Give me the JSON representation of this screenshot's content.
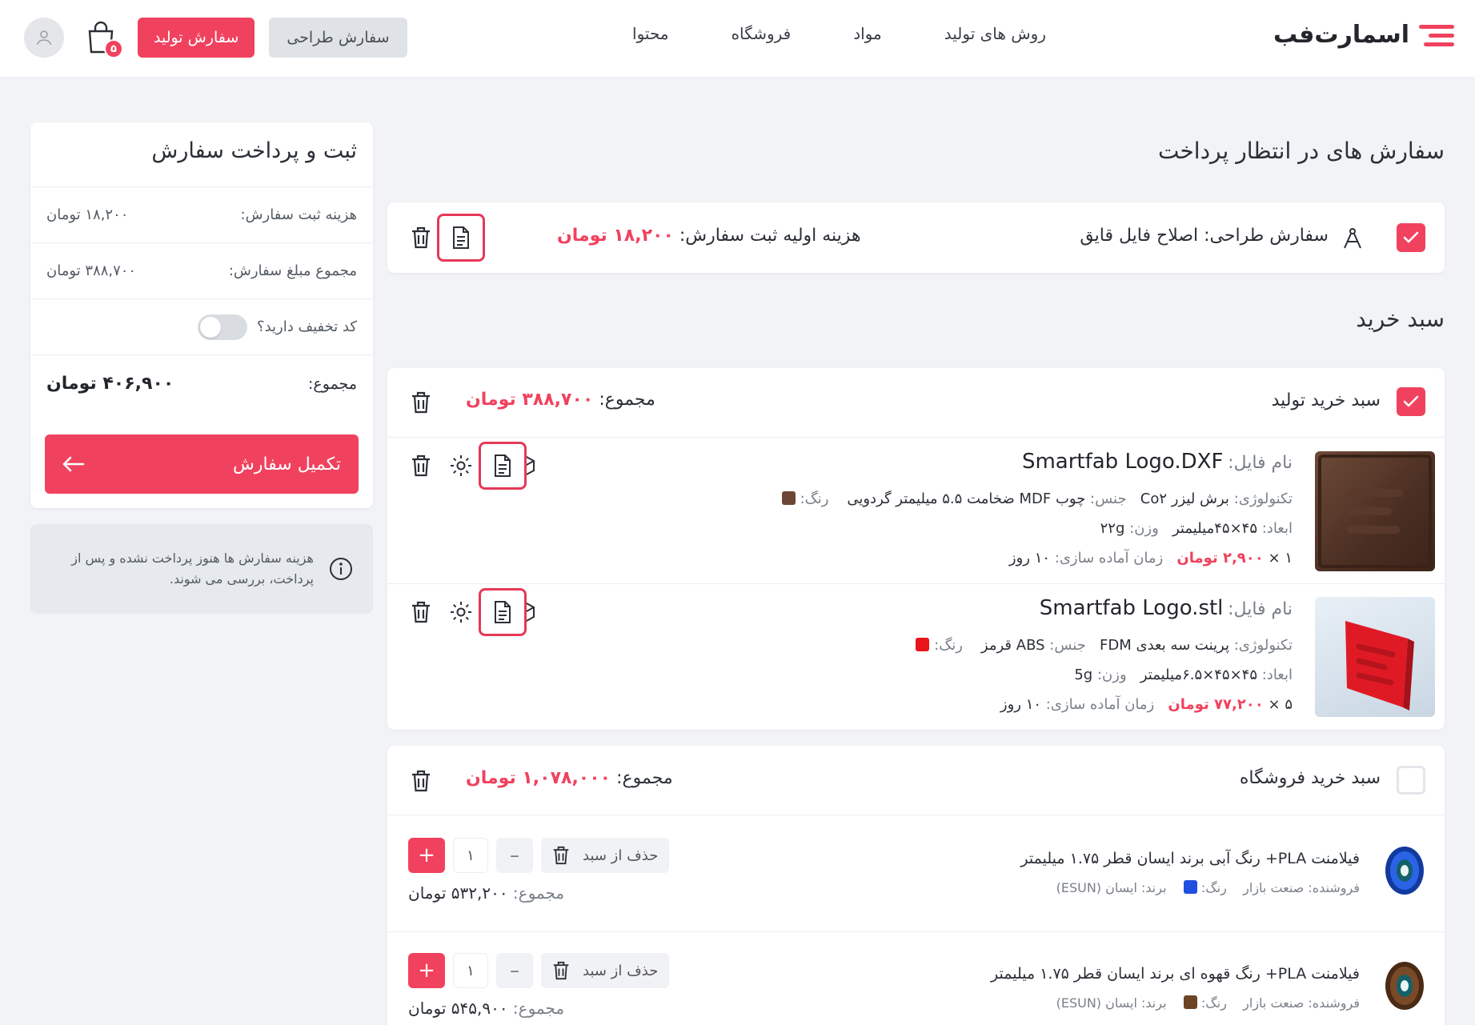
{
  "header": {
    "logo_text": "اسمارت‌فب",
    "nav": [
      "روش های تولید",
      "مواد",
      "فروشگاه",
      "محتوا"
    ],
    "design_order_label": "سفارش طراحی",
    "production_order_label": "سفارش تولید",
    "cart_count": "۵"
  },
  "summary": {
    "title": "ثبت و پرداخت سفارش",
    "reg_fee_label": "هزینه ثبت سفارش:",
    "reg_fee_value": "۱۸,۲۰۰ تومان",
    "order_total_label": "مجموع مبلغ سفارش:",
    "order_total_value": "۳۸۸,۷۰۰ تومان",
    "discount_label": "کد تخفیف دارید؟",
    "total_label": "مجموع:",
    "total_value": "۴۰۶,۹۰۰ تومان",
    "complete_label": "تکمیل سفارش",
    "info_text": "هزینه سفارش ها هنوز پرداخت نشده و پس از پرداخت، بررسی می شوند."
  },
  "pending": {
    "title": "سفارش های در انتظار پرداخت",
    "label": "سفارش طراحی:",
    "name": "اصلاح فایل قایق",
    "fee_label": "هزینه اولیه ثبت سفارش:",
    "fee_value": "۱۸,۲۰۰ تومان"
  },
  "cart": {
    "title": "سبد خرید",
    "production": {
      "title": "سبد خرید تولید",
      "total_label": "مجموع:",
      "total_value": "۳۸۸,۷۰۰ تومان",
      "items": [
        {
          "file_label": "نام فایل:",
          "file_name": "Smartfab Logo.DXF",
          "tech_label": "تکنولوژی:",
          "tech": "برش لیزر Co۲",
          "material_label": "جنس:",
          "material": "چوب MDF ضخامت ۵.۵ میلیمتر گردویی",
          "color_label": "رنگ:",
          "color": "#6b4634",
          "dims_label": "ابعاد:",
          "dims": "۴۵×۴۵میلیمتر",
          "weight_label": "وزن:",
          "weight": "۲۲g",
          "qty": "۱ ×",
          "price": "۲,۹۰۰ تومان",
          "prep_label": "زمان آماده سازی:",
          "prep": "۱۰ روز"
        },
        {
          "file_label": "نام فایل:",
          "file_name": "Smartfab Logo.stl",
          "tech_label": "تکنولوژی:",
          "tech": "پرینت سه بعدی FDM",
          "material_label": "جنس:",
          "material": "ABS قرمز",
          "color_label": "رنگ:",
          "color": "#e8141a",
          "dims_label": "ابعاد:",
          "dims": "۴۵×۴۵×۶.۵میلیمتر",
          "weight_label": "وزن:",
          "weight": "5g",
          "qty": "۵ ×",
          "price": "۷۷,۲۰۰ تومان",
          "prep_label": "زمان آماده سازی:",
          "prep": "۱۰ روز"
        }
      ]
    },
    "shop": {
      "title": "سبد خرید فروشگاه",
      "total_label": "مجموع:",
      "total_value": "۱,۰۷۸,۰۰۰ تومان",
      "items": [
        {
          "name": "فیلامنت PLA+ رنگ آبی برند ایسان قطر ۱.۷۵ میلیمتر",
          "seller_label": "فروشنده:",
          "seller": "صنعت بازار",
          "color_label": "رنگ:",
          "color": "#1e4fe0",
          "brand_label": "برند:",
          "brand": "ایسان (ESUN)",
          "remove_label": "حذف از سبد",
          "qty": "۱",
          "total_label": "مجموع:",
          "total_value": "۵۳۲,۲۰۰ تومان"
        },
        {
          "name": "فیلامنت PLA+ رنگ قهوه ای برند ایسان قطر ۱.۷۵ میلیمتر",
          "seller_label": "فروشنده:",
          "seller": "صنعت بازار",
          "color_label": "رنگ:",
          "color": "#6e4424",
          "brand_label": "برند:",
          "brand": "ایسان (ESUN)",
          "remove_label": "حذف از سبد",
          "qty": "۱",
          "total_label": "مجموع:",
          "total_value": "۵۴۵,۹۰۰ تومان"
        }
      ]
    }
  },
  "colors": {
    "accent": "#f0425e",
    "bg": "#f2f3f6"
  }
}
